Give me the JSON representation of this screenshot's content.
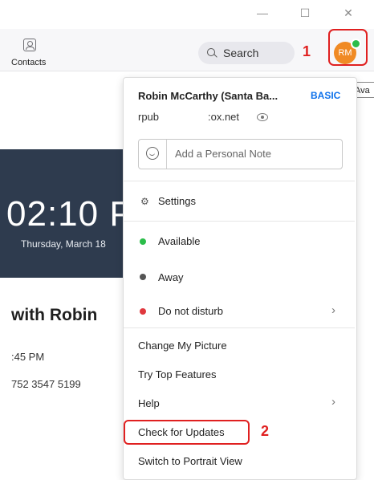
{
  "window": {
    "minimize": "—",
    "maximize": "☐",
    "close": "✕"
  },
  "toolbar": {
    "contacts_label": "Contacts",
    "search_label": "Search",
    "avatar_initials": "RM",
    "tooltip": "Ava"
  },
  "annotations": {
    "step1": "1",
    "step2": "2"
  },
  "background": {
    "clock": "02:10 P",
    "date": "Thursday, March 18",
    "meeting_title": "with Robin",
    "meeting_time": ":45 PM",
    "meeting_id": "752 3547 5199"
  },
  "profile": {
    "name": "Robin McCarthy (Santa Ba...",
    "plan": "BASIC",
    "email_part1": "rpub",
    "email_part2": ":ox.net",
    "note_placeholder": "Add a Personal Note"
  },
  "menu": {
    "settings": "Settings",
    "available": "Available",
    "away": "Away",
    "dnd": "Do not disturb",
    "change_picture": "Change My Picture",
    "top_features": "Try Top Features",
    "help": "Help",
    "check_updates": "Check for Updates",
    "portrait_view": "Switch to Portrait View"
  },
  "colors": {
    "available": "#2bbd4a",
    "away": "#555555",
    "dnd": "#e0383e",
    "annotation": "#e02020",
    "plan": "#0e71eb",
    "avatar": "#f08a24"
  }
}
